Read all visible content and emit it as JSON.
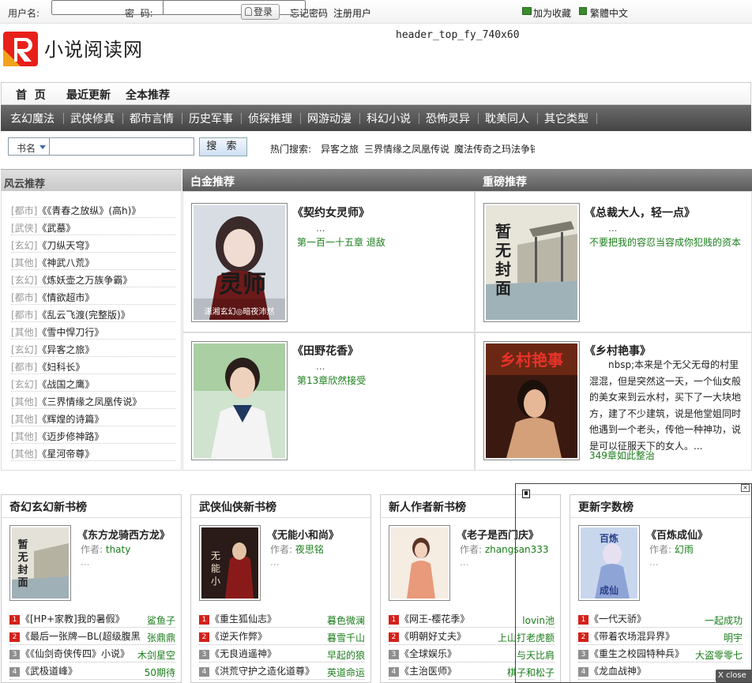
{
  "topbar": {
    "username_label": "用户名:",
    "password_label": "密  码:",
    "login_button": "登录",
    "forgot_link": "忘记密码",
    "register_link": "注册用户",
    "favorite_link": "加为收藏",
    "traditional_link": "繁體中文"
  },
  "header": {
    "logo_text": "小说阅读网",
    "ad_placeholder": "header_top_fy_740x60"
  },
  "main_nav": [
    "首  页",
    "最近更新",
    "全本推荐"
  ],
  "category_nav": [
    "玄幻魔法",
    "武侠修真",
    "都市言情",
    "历史军事",
    "侦探推理",
    "网游动漫",
    "科幻小说",
    "恐怖灵异",
    "耽美同人",
    "其它类型"
  ],
  "search": {
    "select_value": "书名",
    "button_label": "搜  索",
    "hot_label": "热门搜索:",
    "hot_items": [
      "异客之旅",
      "三界情缘之凤凰传说",
      "魔法传奇之玛法争锋"
    ]
  },
  "sections": {
    "fengyun": "风云推荐",
    "baijin": "白金推荐",
    "zhongbang": "重磅推荐"
  },
  "fengyun_list": [
    {
      "tag": "[都市]",
      "title": "《《青春之放纵》(高h)》"
    },
    {
      "tag": "[武侠]",
      "title": "《武墓》"
    },
    {
      "tag": "[玄幻]",
      "title": "《刀纵天穹》"
    },
    {
      "tag": "[其他]",
      "title": "《神武八荒》"
    },
    {
      "tag": "[玄幻]",
      "title": "《炼妖壶之万族争霸》"
    },
    {
      "tag": "[都市]",
      "title": "《情欲超市》"
    },
    {
      "tag": "[都市]",
      "title": "《乱云飞渡(完整版)》"
    },
    {
      "tag": "[其他]",
      "title": "《雪中悍刀行》"
    },
    {
      "tag": "[玄幻]",
      "title": "《异客之旅》"
    },
    {
      "tag": "[都市]",
      "title": "《妇科长》"
    },
    {
      "tag": "[玄幻]",
      "title": "《战国之鹰》"
    },
    {
      "tag": "[其他]",
      "title": "《三界情缘之凤凰传说》"
    },
    {
      "tag": "[其他]",
      "title": "《辉煌的诗篇》"
    },
    {
      "tag": "[其他]",
      "title": "《迈步修神路》"
    },
    {
      "tag": "[其他]",
      "title": "《星河帝尊》"
    }
  ],
  "baijin": [
    {
      "title": "《契约女灵师》",
      "dots": "...",
      "chapter": "第一百一十五章 退敌",
      "cover_text": "灵师",
      "cover_sub": "潇湘玄幻◎暗夜沛然"
    },
    {
      "title": "《田野花香》",
      "dots": "...",
      "chapter": "第13章欣然接受"
    }
  ],
  "zhongbang": [
    {
      "title": "《总裁大人，轻一点》",
      "dots": "...",
      "chapter": "不要把我的容忍当容成你犯贱的资本",
      "cover_text": "暂无封面"
    },
    {
      "title": "《乡村艳事》",
      "desc": "nbsp;本来是个无父无母的村里混混，但是突然这一天，一个仙女般的美女来到云水村，买下了一大块地方，建了不少建筑，说是他堂姐同时他遇到一个老头，传他一种神功，说是可以征服天下的女人。...",
      "chapter": "349章如此整治",
      "cover_text": "乡村艳事"
    }
  ],
  "columns": [
    {
      "title": "奇幻玄幻新书榜",
      "book": "《东方龙骑西方龙》",
      "author_label": "作者:",
      "author": "thaty",
      "dots": "...",
      "cover_text": "暂无封面",
      "ranks": [
        {
          "n": "1",
          "name": "《[HP+家教]我的暑假》",
          "author": "鲨鱼子"
        },
        {
          "n": "2",
          "name": "《最后一张牌—BL(超级腹黑",
          "author": "张鼎鼎"
        },
        {
          "n": "3",
          "name": "《《仙剑奇侠传四》小说》",
          "author": "木剑星空"
        },
        {
          "n": "4",
          "name": "《武极道峰》",
          "author": "50期待"
        }
      ]
    },
    {
      "title": "武侠仙侠新书榜",
      "book": "《无能小和尚》",
      "author_label": "作者:",
      "author": "夜思铭",
      "dots": "...",
      "cover_text": "无能小和尚",
      "ranks": [
        {
          "n": "1",
          "name": "《重生狐仙志》",
          "author": "暮色微澜"
        },
        {
          "n": "2",
          "name": "《逆天作弊》",
          "author": "暮雪千山"
        },
        {
          "n": "3",
          "name": "《无良逍遥神》",
          "author": "早起的狼"
        },
        {
          "n": "4",
          "name": "《洪荒守护之造化道尊》",
          "author": "英道命运"
        }
      ]
    },
    {
      "title": "新人作者新书榜",
      "book": "《老子是西门庆》",
      "author_label": "作者:",
      "author": "zhangsan333",
      "dots": "...",
      "cover_text": "",
      "ranks": [
        {
          "n": "1",
          "name": "《网王-樱花季》",
          "author": "lovin池"
        },
        {
          "n": "2",
          "name": "《明朝好丈夫》",
          "author": "上山打老虎额"
        },
        {
          "n": "3",
          "name": "《全球娱乐》",
          "author": "与天比肩"
        },
        {
          "n": "4",
          "name": "《主治医师》",
          "author": "棋子和松子"
        }
      ]
    },
    {
      "title": "更新字数榜",
      "book": "《百炼成仙》",
      "author_label": "作者:",
      "author": "幻雨",
      "dots": "...",
      "cover_text": "百炼成仙",
      "ranks": [
        {
          "n": "1",
          "name": "《一代天骄》",
          "author": "一起成功"
        },
        {
          "n": "2",
          "name": "《带着农场混异界》",
          "author": "明宇"
        },
        {
          "n": "3",
          "name": "《重生之校园特种兵》",
          "author": "大盗零零七"
        },
        {
          "n": "4",
          "name": "《龙血战神》",
          "author": ""
        }
      ]
    }
  ],
  "float_close": "X close",
  "float_x": "×",
  "colors": {
    "rank1": "#d4201a",
    "rank2": "#d4201a",
    "rank3": "#d4201a",
    "rank4": "#8f8f8f",
    "link_green": "#1a7d1a"
  }
}
